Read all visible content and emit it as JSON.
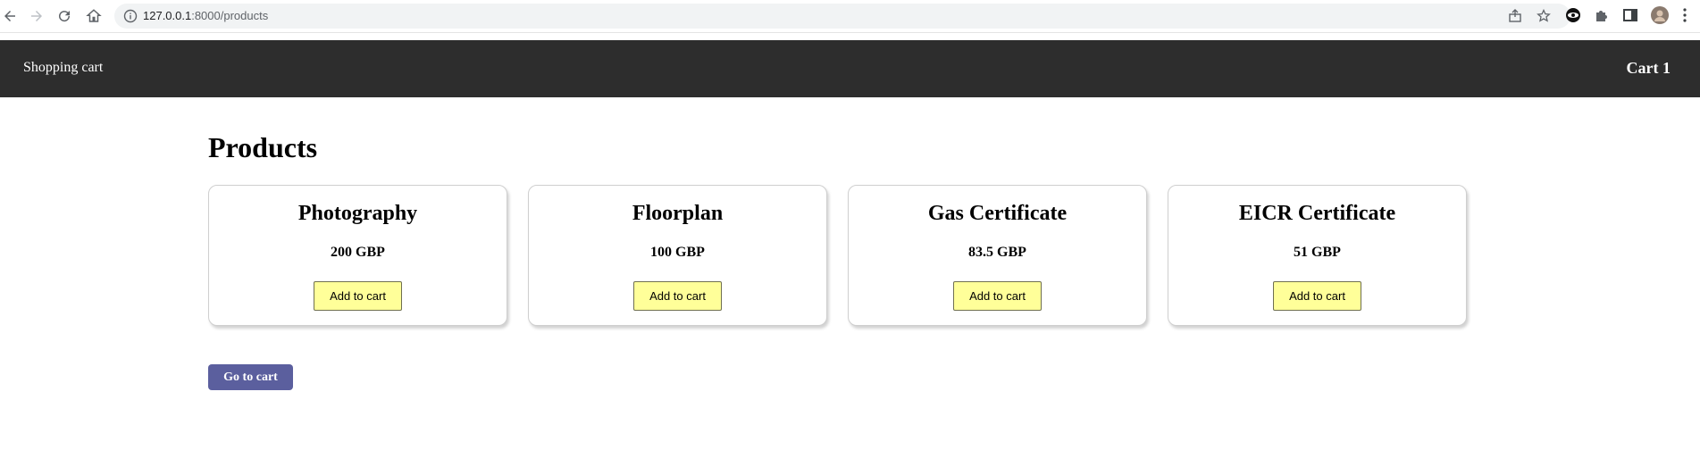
{
  "browser": {
    "url_host": "127.0.0.1",
    "url_path": ":8000/products"
  },
  "header": {
    "brand": "Shopping cart",
    "cart_label": "Cart 1"
  },
  "main": {
    "title": "Products",
    "products": [
      {
        "name": "Photography",
        "price": "200 GBP",
        "button": "Add to cart"
      },
      {
        "name": "Floorplan",
        "price": "100 GBP",
        "button": "Add to cart"
      },
      {
        "name": "Gas Certificate",
        "price": "83.5 GBP",
        "button": "Add to cart"
      },
      {
        "name": "EICR Certificate",
        "price": "51 GBP",
        "button": "Add to cart"
      }
    ],
    "go_to_cart": "Go to cart"
  },
  "colors": {
    "header_bg": "#2d2d2d",
    "add_button_bg": "#ffff99",
    "go_cart_bg": "#5b5f9e"
  }
}
